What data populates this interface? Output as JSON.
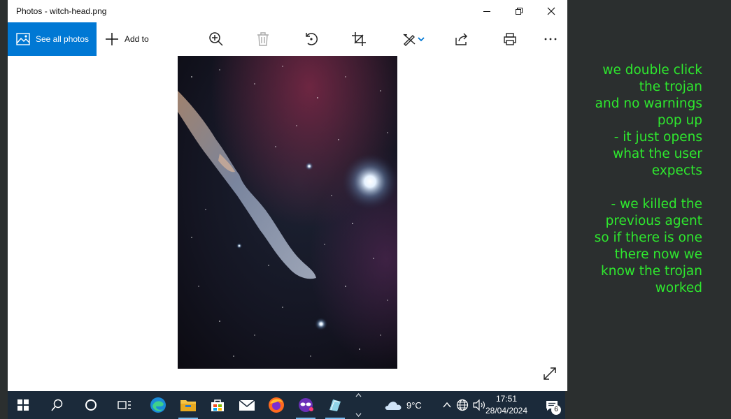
{
  "window": {
    "title": "Photos - witch-head.png"
  },
  "toolbar": {
    "see_all_label": "See all photos",
    "add_to_label": "Add to",
    "icons": [
      "zoom-icon",
      "delete-icon",
      "rotate-icon",
      "crop-icon",
      "edit-create-icon",
      "chevron-down-icon",
      "share-icon",
      "print-icon",
      "more-icon"
    ]
  },
  "note": {
    "text": "we double click\nthe trojan\nand no warnings\npop up\n- it just opens\nwhat the user\nexpects\n\n- we killed the\nprevious agent\nso if there is one\nthere now we\nknow the trojan\nworked"
  },
  "taskbar": {
    "apps": [
      "start-icon",
      "search-icon",
      "cortana-icon",
      "task-view-icon",
      "edge-icon",
      "file-explorer-icon",
      "store-icon",
      "mail-icon",
      "firefox-icon",
      "app-icon",
      "app2-icon"
    ]
  },
  "tray": {
    "temperature": "9°C",
    "time": "17:51",
    "date": "28/04/2024",
    "notification_count": "6"
  },
  "colors": {
    "accent": "#0078d4",
    "note_green": "#2ee82e",
    "taskbar": "#1b2a3a"
  }
}
